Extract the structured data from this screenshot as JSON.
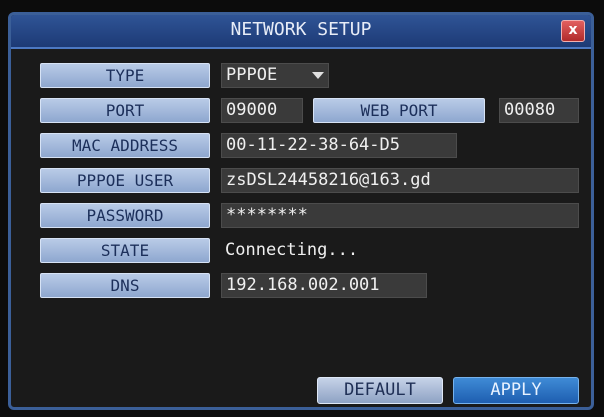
{
  "window": {
    "title": "NETWORK SETUP",
    "close_label": "x"
  },
  "fields": {
    "type": {
      "label": "TYPE",
      "value": "PPPOE"
    },
    "port": {
      "label": "PORT",
      "value": "09000"
    },
    "web_port": {
      "label": "WEB PORT",
      "value": "00080"
    },
    "mac": {
      "label": "MAC ADDRESS",
      "value": "00-11-22-38-64-D5"
    },
    "pppoe_user": {
      "label": "PPPOE USER",
      "value": "zsDSL24458216@163.gd"
    },
    "password": {
      "label": "PASSWORD",
      "value": "********"
    },
    "state": {
      "label": "STATE",
      "value": "Connecting..."
    },
    "dns": {
      "label": "DNS",
      "value": "192.168.002.001"
    }
  },
  "buttons": {
    "default_label": "DEFAULT",
    "apply_label": "APPLY"
  },
  "icons": {
    "close": "close-icon",
    "dropdown": "chevron-down-icon"
  },
  "colors": {
    "titlebar": "#2f5496",
    "label_bg": "#a9bde0",
    "value_bg": "#3a3a3a",
    "apply_button": "#2f73c4",
    "close_button": "#c83c3c"
  }
}
